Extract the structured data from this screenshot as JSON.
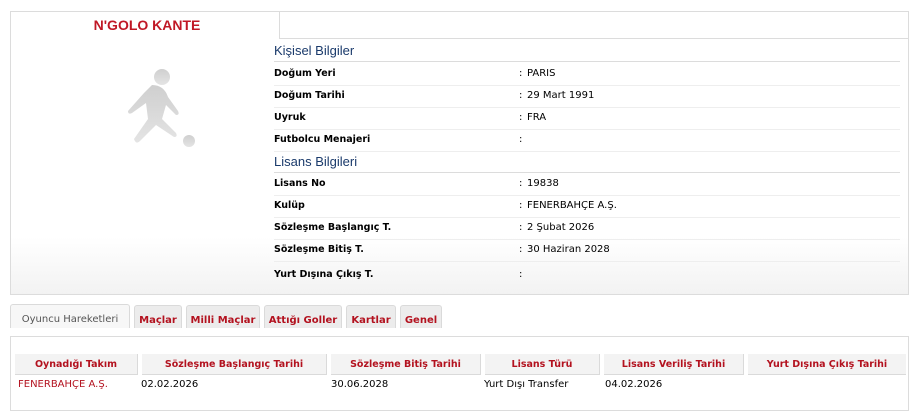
{
  "player": {
    "name": "N'GOLO KANTE",
    "photo_icon": "player-silhouette-icon"
  },
  "personal": {
    "title": "Kişisel Bilgiler",
    "rows": [
      {
        "label": "Doğum Yeri",
        "value": "PARIS"
      },
      {
        "label": "Doğum Tarihi",
        "value": "29 Mart 1991"
      },
      {
        "label": "Uyruk",
        "value": "FRA"
      },
      {
        "label": "Futbolcu Menajeri",
        "value": ""
      }
    ]
  },
  "license": {
    "title": "Lisans Bilgileri",
    "rows": [
      {
        "label": "Lisans No",
        "value": "19838"
      },
      {
        "label": "Kulüp",
        "value": "FENERBAHÇE A.Ş."
      },
      {
        "label": "Sözleşme Başlangıç T.",
        "value": "2 Şubat 2026"
      },
      {
        "label": "Sözleşme Bitiş T.",
        "value": "30 Haziran 2028"
      },
      {
        "label": "Yurt Dışına Çıkış T.",
        "value": ""
      }
    ]
  },
  "tabs": [
    {
      "label": "Oyuncu Hareketleri",
      "active": true
    },
    {
      "label": "Maçlar",
      "active": false
    },
    {
      "label": "Milli Maçlar",
      "active": false
    },
    {
      "label": "Attığı Goller",
      "active": false
    },
    {
      "label": "Kartlar",
      "active": false
    },
    {
      "label": "Genel",
      "active": false
    }
  ],
  "table": {
    "columns": [
      "Oynadığı Takım",
      "Sözleşme Başlangıç Tarihi",
      "Sözleşme Bitiş Tarihi",
      "Lisans Türü",
      "Lisans Veriliş Tarihi",
      "Yurt Dışına Çıkış Tarihi"
    ],
    "rows": [
      [
        "FENERBAHÇE A.Ş.",
        "02.02.2026",
        "30.06.2028",
        "Yurt Dışı Transfer",
        "04.02.2026",
        ""
      ]
    ]
  },
  "colors": {
    "accent_red": "#b3121f",
    "title_blue": "#1a3a6b"
  }
}
